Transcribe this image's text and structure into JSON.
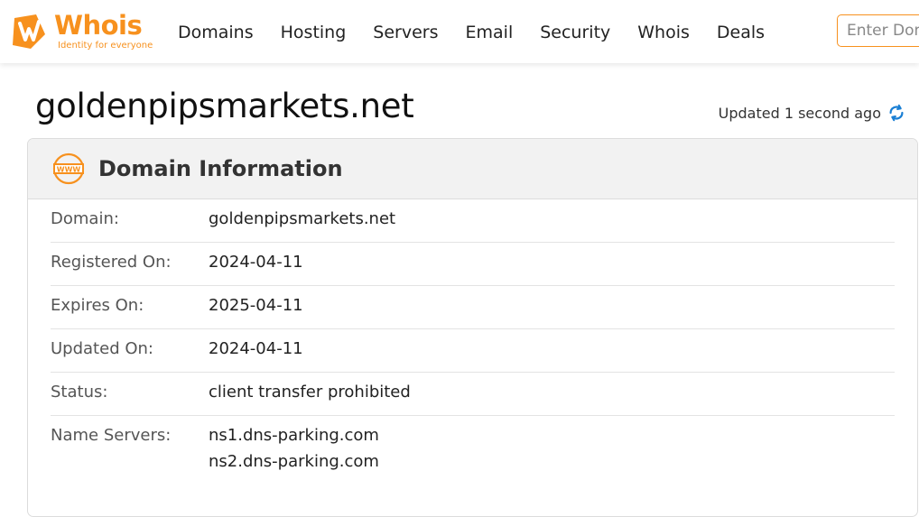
{
  "brand": {
    "name": "Whois",
    "tagline": "Identity for everyone",
    "color": "#f7911e"
  },
  "nav": {
    "items": [
      {
        "label": "Domains"
      },
      {
        "label": "Hosting"
      },
      {
        "label": "Servers"
      },
      {
        "label": "Email"
      },
      {
        "label": "Security"
      },
      {
        "label": "Whois"
      },
      {
        "label": "Deals"
      }
    ]
  },
  "search": {
    "placeholder": "Enter Domain or IP",
    "value": ""
  },
  "page": {
    "title": "goldenpipsmarkets.net",
    "updated": "Updated 1 second ago",
    "refresh_icon": "refresh-icon",
    "accent": "#1a7fd4"
  },
  "card": {
    "title": "Domain Information",
    "icon": "www-icon",
    "rows": [
      {
        "label": "Domain:",
        "values": [
          "goldenpipsmarkets.net"
        ]
      },
      {
        "label": "Registered On:",
        "values": [
          "2024-04-11"
        ]
      },
      {
        "label": "Expires On:",
        "values": [
          "2025-04-11"
        ]
      },
      {
        "label": "Updated On:",
        "values": [
          "2024-04-11"
        ]
      },
      {
        "label": "Status:",
        "values": [
          "client transfer prohibited"
        ]
      },
      {
        "label": "Name Servers:",
        "values": [
          "ns1.dns-parking.com",
          "ns2.dns-parking.com"
        ]
      }
    ]
  }
}
